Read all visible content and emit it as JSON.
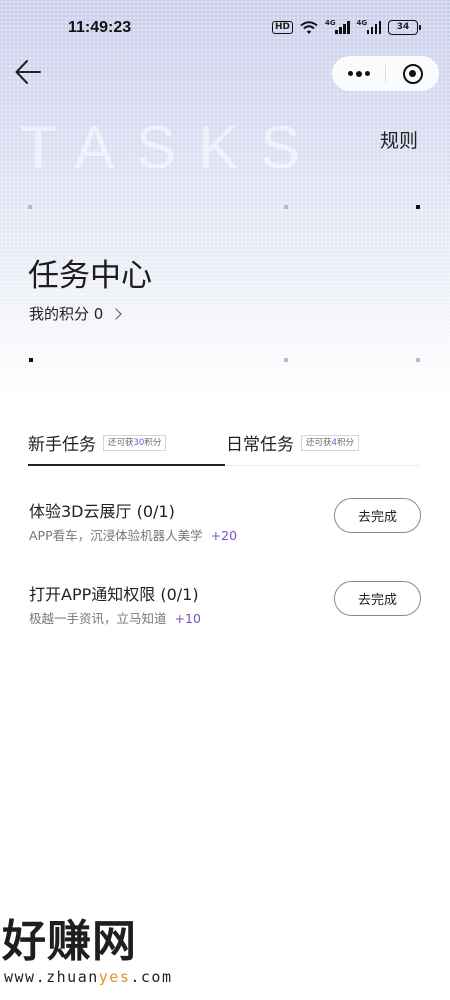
{
  "status_bar": {
    "time": "11:49:23",
    "hd_label": "HD",
    "signal_1_label": "4G",
    "signal_2_label": "4G",
    "battery": "34"
  },
  "nav": {
    "back_icon": "arrow-left-icon",
    "more_icon": "more-dots-icon",
    "close_icon": "target-close-icon"
  },
  "header": {
    "decor_text": "TASKS",
    "rules_label": "规则",
    "title": "任务中心",
    "points_label": "我的积分 0"
  },
  "tabs": [
    {
      "label": "新手任务",
      "badge_prefix": "还可获",
      "badge_value": "30",
      "badge_suffix": "积分",
      "active": true
    },
    {
      "label": "日常任务",
      "badge_prefix": "还可获",
      "badge_value": "4",
      "badge_suffix": "积分",
      "active": false
    }
  ],
  "tasks": [
    {
      "title": "体验3D云展厅 (0/1)",
      "desc": "APP看车，沉浸体验机器人美学",
      "reward": "+20",
      "button": "去完成"
    },
    {
      "title": "打开APP通知权限 (0/1)",
      "desc": "极越一手资讯，立马知道",
      "reward": "+10",
      "button": "去完成"
    }
  ],
  "watermark": {
    "logo_text": "好赚网",
    "url_prefix": "www.zhuan",
    "url_highlight": "yes",
    "url_suffix": ".com"
  },
  "colors": {
    "accent": "#7a52c2",
    "hero_top": "#ccd0ec",
    "watermark_highlight": "#e0902a"
  }
}
